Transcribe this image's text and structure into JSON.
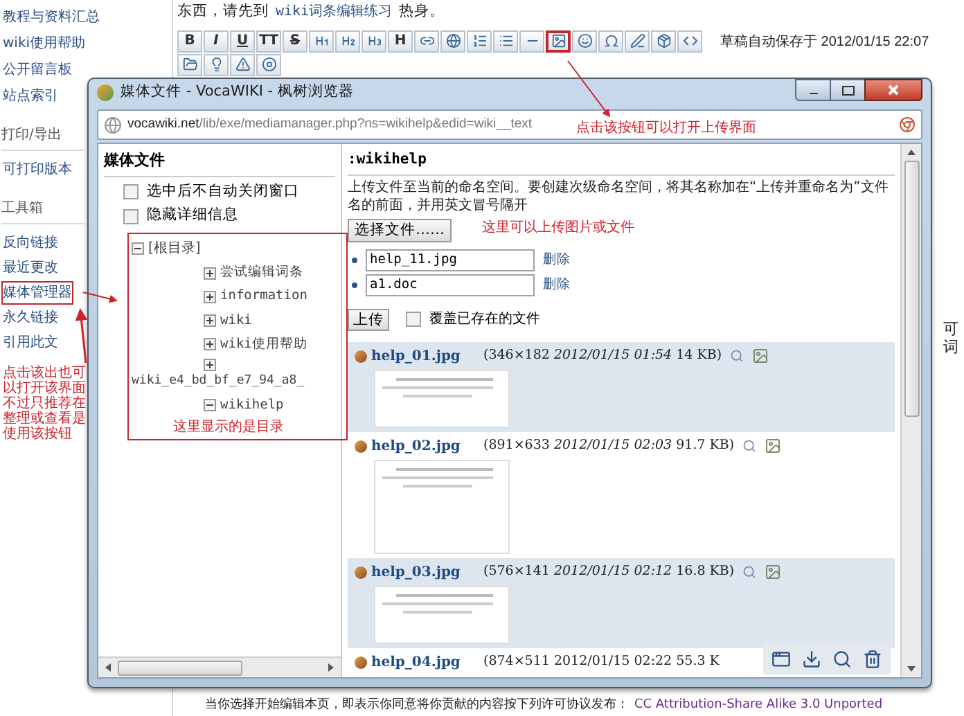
{
  "sidebar": {
    "links": [
      {
        "label": "教程与资料汇总",
        "highlighted": false
      },
      {
        "label": "wiki使用帮助",
        "highlighted": false
      },
      {
        "label": "公开留言板",
        "highlighted": false
      },
      {
        "label": "站点索引",
        "highlighted": false
      }
    ],
    "sections": [
      {
        "title": "打印/导出",
        "links": [
          {
            "label": "可打印版本",
            "highlighted": false
          }
        ]
      },
      {
        "title": "工具箱",
        "links": [
          {
            "label": "反向链接",
            "highlighted": false
          },
          {
            "label": "最近更改",
            "highlighted": false
          },
          {
            "label": "媒体管理器",
            "highlighted": true
          },
          {
            "label": "永久链接",
            "highlighted": false
          },
          {
            "label": "引用此文",
            "highlighted": false
          }
        ]
      }
    ]
  },
  "intro": {
    "before": "东西，请先到",
    "link": "wiki词条编辑练习",
    "after": "热身。"
  },
  "toolbar": {
    "rows": [
      [
        {
          "label": "B",
          "highlighted": false
        },
        {
          "label": "I",
          "highlighted": false
        },
        {
          "label": "U",
          "highlighted": false
        },
        {
          "label": "TT",
          "highlighted": false
        },
        {
          "label": "S",
          "highlighted": false
        },
        {
          "highlighted": false
        },
        {
          "highlighted": false
        },
        {
          "highlighted": false
        },
        {
          "label": "H",
          "highlighted": false
        },
        {
          "highlighted": false
        },
        {
          "highlighted": false
        },
        {
          "highlighted": false
        },
        {
          "highlighted": false
        },
        {
          "highlighted": false
        },
        {
          "highlighted": true
        },
        {
          "highlighted": false
        },
        {
          "highlighted": false
        },
        {
          "highlighted": false
        },
        {
          "highlighted": false
        },
        {
          "highlighted": false
        }
      ],
      [
        {
          "highlighted": false
        },
        {
          "highlighted": false
        },
        {
          "highlighted": false
        },
        {
          "highlighted": false
        }
      ]
    ],
    "autosave": "草稿自动保存于 2012/01/15 22:07"
  },
  "page_fragments": [
    "可",
    "词"
  ],
  "license": {
    "text": "当你选择开始编辑本页，即表示你同意将你贡献的内容按下列许可协议发布：",
    "link": "CC Attribution-Share Alike 3.0 Unported"
  },
  "dialog": {
    "title": "媒体文件 - VocaWIKI - 枫树浏览器",
    "url_host": "vocawiki.net",
    "url_path": "/lib/exe/mediamanager.php?ns=wikihelp&edid=wiki__text",
    "left": {
      "heading": "媒体文件",
      "options": [
        {
          "label": "选中后不自动关闭窗口",
          "checked": false
        },
        {
          "label": "隐藏详细信息",
          "checked": false
        }
      ],
      "tree": {
        "label": "[根目录]",
        "expanded": true,
        "children": [
          {
            "label": "尝试编辑词条",
            "expanded": false
          },
          {
            "label": "information",
            "expanded": false
          },
          {
            "label": "wiki",
            "expanded": false
          },
          {
            "label": "wiki使用帮助",
            "expanded": false
          },
          {
            "label": "wiki_e4_bd_bf_e7_94_a8_",
            "expanded": false
          },
          {
            "label": "wikihelp",
            "expanded": true
          }
        ]
      }
    },
    "right": {
      "heading": ":wikihelp",
      "description": "上传文件至当前的命名空间。要创建次级命名空间，将其名称加在“上传并重命名为”文件名的前面，并用英文冒号隔开",
      "choose_button": "选择文件……",
      "files": [
        {
          "value": "help_11.jpg",
          "remove": "删除"
        },
        {
          "value": "a1.doc",
          "remove": "删除"
        }
      ],
      "upload_button": "上传",
      "overwrite": {
        "label": "覆盖已存在的文件",
        "checked": false
      },
      "media": [
        {
          "name": "help_01.jpg",
          "info": "(346×182 *2012/01/15 01:54* 14 KB)",
          "shaded": true
        },
        {
          "name": "help_02.jpg",
          "info": "(891×633 *2012/01/15 02:03* 91.7 KB)",
          "shaded": false
        },
        {
          "name": "help_03.jpg",
          "info": "(576×141 *2012/01/15 02:12* 16.8 KB)",
          "shaded": true
        },
        {
          "name": "help_04.jpg",
          "info": "(874×511 2012/01/15 02:22 55.3 K",
          "shaded": false
        }
      ]
    }
  },
  "annotations": {
    "upload_button_note": "点击该按钮可以打开上传界面",
    "upload_note": "这里可以上传图片或文件",
    "tree_note": "这里显示的是目录",
    "sidebar_note": "点击该出也可以打开该界面不过只推荐在整理或查看是使用该按钮"
  }
}
